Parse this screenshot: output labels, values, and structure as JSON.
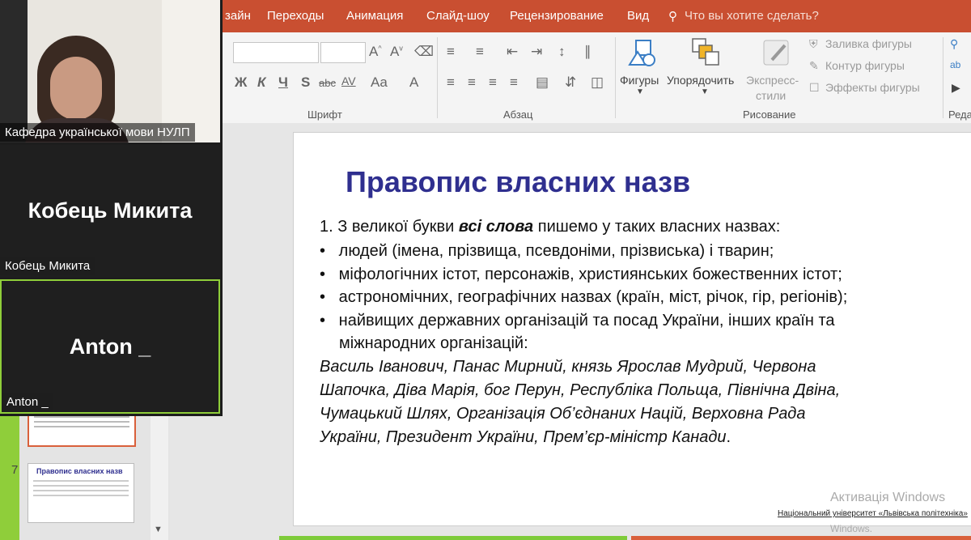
{
  "menu": {
    "tabs": [
      "Дизайн",
      "Переходы",
      "Анимация",
      "Слайд-шоу",
      "Рецензирование",
      "Вид"
    ],
    "tab_fragment": "зайн",
    "tell_me": "Что вы хотите сделать?"
  },
  "ribbon": {
    "font_group_label": "Шрифт",
    "paragraph_group_label": "Абзац",
    "drawing_group_label": "Рисование",
    "editing_group_label_fragment": "Реда",
    "shapes_label": "Фигуры",
    "arrange_label": "Упорядочить",
    "quick_styles_label_1": "Экспресс-",
    "quick_styles_label_2": "стили",
    "shape_fill": "Заливка фигуры",
    "shape_outline": "Контур фигуры",
    "shape_effects": "Эффекты фигуры",
    "font_buttons": [
      "Ж",
      "К",
      "Ч",
      "S",
      "abc",
      "AV",
      "Aa",
      "A"
    ]
  },
  "slide": {
    "title": "Правопис власних назв",
    "intro_prefix": "1. З великої букви ",
    "intro_bold": "всі слова",
    "intro_suffix": " пишемо у таких власних назвах:",
    "bullets": [
      "людей (імена, прізвища, псевдоніми, прізвиська) і тварин;",
      "міфологічних істот, персонажів, християнських божественних істот;",
      "астрономічних, географічних назвах (країн, міст, річок, гір, регіонів);",
      "найвищих державних організацій та посад України, інших країн та"
    ],
    "bullet4_cont": "міжнародних організацій:",
    "examples": [
      "Василь Іванович, Панас Мирний, князь Ярослав Мудрий, Червона",
      "Шапочка, Діва Марія, бог Перун, Республіка Польща, Північна Двіна,",
      "Чумацький Шлях, Організація Об’єднаних Націй, Верховна Рада",
      "України, Президент України, Прем’єр-міністр Канади"
    ],
    "examples_end": ".",
    "footer": "Національний університет «Львівська політехніка»"
  },
  "thumbs": {
    "slide_number": "7",
    "thumb_title": "Правопис власних назв"
  },
  "watermark": {
    "line1": "Активація Windows",
    "line2": "Windows."
  },
  "zoom": {
    "participants": [
      {
        "name": "",
        "label": "Кафедра української мови НУЛП"
      },
      {
        "name": "Кобець Микита",
        "label": "Кобець Микита"
      },
      {
        "name": "Anton _",
        "label": "Anton _"
      }
    ]
  },
  "colors": {
    "menubar": "#c94f31",
    "title": "#2f2f8f",
    "active_speaker_border": "#8fce3a"
  }
}
